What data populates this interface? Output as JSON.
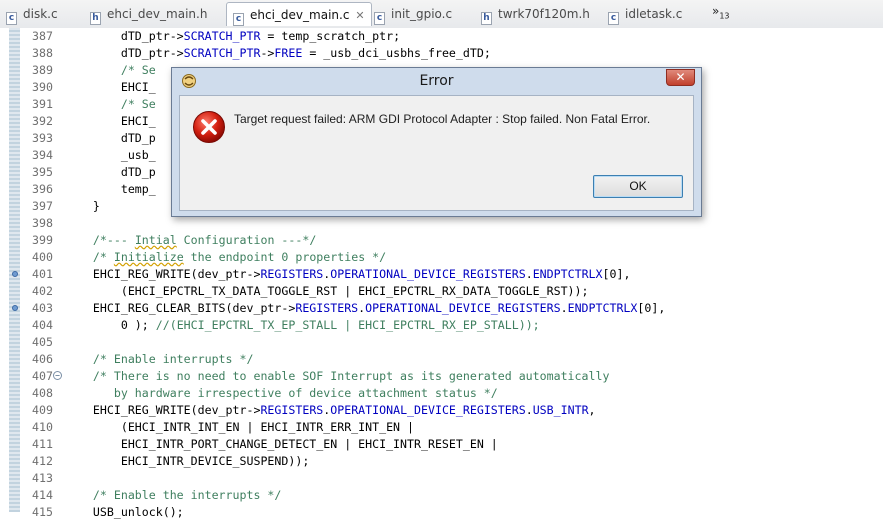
{
  "tabs": [
    {
      "label": "disk.c"
    },
    {
      "label": "ehci_dev_main.h"
    },
    {
      "label": "ehci_dev_main.c"
    },
    {
      "label": "init_gpio.c"
    },
    {
      "label": "twrk70f120m.h"
    },
    {
      "label": "idletask.c"
    }
  ],
  "tabbar": {
    "overflow_symbol": "»",
    "overflow_count": "13",
    "close_glyph": "✕"
  },
  "dialog": {
    "title": "Error",
    "message": "Target request failed: ARM GDI Protocol Adapter : Stop failed. Non Fatal Error.",
    "ok_label": "OK",
    "close_glyph": "✕"
  },
  "code_lines": [
    {
      "n": "387",
      "segs": [
        {
          "t": "        dTD_ptr->"
        },
        {
          "t": "SCRATCH_PTR",
          "c": "fld"
        },
        {
          "t": " = temp_scratch_ptr;"
        }
      ]
    },
    {
      "n": "388",
      "segs": [
        {
          "t": "        dTD_ptr->"
        },
        {
          "t": "SCRATCH_PTR",
          "c": "fld"
        },
        {
          "t": "->"
        },
        {
          "t": "FREE",
          "c": "fld"
        },
        {
          "t": " = _usb_dci_usbhs_free_dTD;"
        }
      ]
    },
    {
      "n": "389",
      "segs": [
        {
          "t": "        "
        },
        {
          "t": "/* Se",
          "c": "cm"
        }
      ]
    },
    {
      "n": "390",
      "segs": [
        {
          "t": "        EHCI_"
        }
      ]
    },
    {
      "n": "391",
      "segs": [
        {
          "t": "        "
        },
        {
          "t": "/* Se",
          "c": "cm"
        }
      ]
    },
    {
      "n": "392",
      "segs": [
        {
          "t": "        EHCI_"
        }
      ]
    },
    {
      "n": "393",
      "segs": [
        {
          "t": "        dTD_p"
        }
      ]
    },
    {
      "n": "394",
      "segs": [
        {
          "t": "        _usb_"
        }
      ]
    },
    {
      "n": "395",
      "segs": [
        {
          "t": "        dTD_p"
        }
      ]
    },
    {
      "n": "396",
      "segs": [
        {
          "t": "        temp_"
        }
      ]
    },
    {
      "n": "397",
      "segs": [
        {
          "t": "    }"
        }
      ]
    },
    {
      "n": "398",
      "segs": []
    },
    {
      "n": "399",
      "segs": [
        {
          "t": "    /*--- ",
          "c": "cm"
        },
        {
          "t": "Intial",
          "c": "cm ul"
        },
        {
          "t": " Configuration ---*/",
          "c": "cm"
        }
      ]
    },
    {
      "n": "400",
      "segs": [
        {
          "t": "    /* ",
          "c": "cm"
        },
        {
          "t": "Initialize",
          "c": "cm ul"
        },
        {
          "t": " the endpoint 0 properties */",
          "c": "cm"
        }
      ]
    },
    {
      "n": "401",
      "mark": true,
      "segs": [
        {
          "t": "    EHCI_REG_WRITE(dev_ptr->"
        },
        {
          "t": "REGISTERS",
          "c": "fld"
        },
        {
          "t": "."
        },
        {
          "t": "OPERATIONAL_DEVICE_REGISTERS",
          "c": "fld"
        },
        {
          "t": "."
        },
        {
          "t": "ENDPTCTRLX",
          "c": "fld"
        },
        {
          "t": "[0],"
        }
      ]
    },
    {
      "n": "402",
      "segs": [
        {
          "t": "        (EHCI_EPCTRL_TX_DATA_TOGGLE_RST | EHCI_EPCTRL_RX_DATA_TOGGLE_RST));"
        }
      ]
    },
    {
      "n": "403",
      "mark": true,
      "segs": [
        {
          "t": "    EHCI_REG_CLEAR_BITS(dev_ptr->"
        },
        {
          "t": "REGISTERS",
          "c": "fld"
        },
        {
          "t": "."
        },
        {
          "t": "OPERATIONAL_DEVICE_REGISTERS",
          "c": "fld"
        },
        {
          "t": "."
        },
        {
          "t": "ENDPTCTRLX",
          "c": "fld"
        },
        {
          "t": "[0],"
        }
      ]
    },
    {
      "n": "404",
      "segs": [
        {
          "t": "        0 ); "
        },
        {
          "t": "//(EHCI_EPCTRL_TX_EP_STALL | EHCI_EPCTRL_RX_EP_STALL));",
          "c": "cm"
        }
      ]
    },
    {
      "n": "405",
      "segs": []
    },
    {
      "n": "406",
      "segs": [
        {
          "t": "    /* Enable interrupts */",
          "c": "cm"
        }
      ]
    },
    {
      "n": "407",
      "fold": true,
      "segs": [
        {
          "t": "    /* There is no need to enable SOF Interrupt as its generated automatically",
          "c": "cm"
        }
      ]
    },
    {
      "n": "408",
      "segs": [
        {
          "t": "       by hardware irrespective of device attachment status */",
          "c": "cm"
        }
      ]
    },
    {
      "n": "409",
      "segs": [
        {
          "t": "    EHCI_REG_WRITE(dev_ptr->"
        },
        {
          "t": "REGISTERS",
          "c": "fld"
        },
        {
          "t": "."
        },
        {
          "t": "OPERATIONAL_DEVICE_REGISTERS",
          "c": "fld"
        },
        {
          "t": "."
        },
        {
          "t": "USB_INTR",
          "c": "fld"
        },
        {
          "t": ","
        }
      ]
    },
    {
      "n": "410",
      "segs": [
        {
          "t": "        (EHCI_INTR_INT_EN | EHCI_INTR_ERR_INT_EN |"
        }
      ]
    },
    {
      "n": "411",
      "segs": [
        {
          "t": "        EHCI_INTR_PORT_CHANGE_DETECT_EN | EHCI_INTR_RESET_EN |"
        }
      ]
    },
    {
      "n": "412",
      "segs": [
        {
          "t": "        EHCI_INTR_DEVICE_SUSPEND));"
        }
      ]
    },
    {
      "n": "413",
      "segs": []
    },
    {
      "n": "414",
      "segs": [
        {
          "t": "    /* Enable the interrupts */",
          "c": "cm"
        }
      ]
    },
    {
      "n": "415",
      "segs": [
        {
          "t": "    USB_unlock();"
        }
      ]
    }
  ]
}
